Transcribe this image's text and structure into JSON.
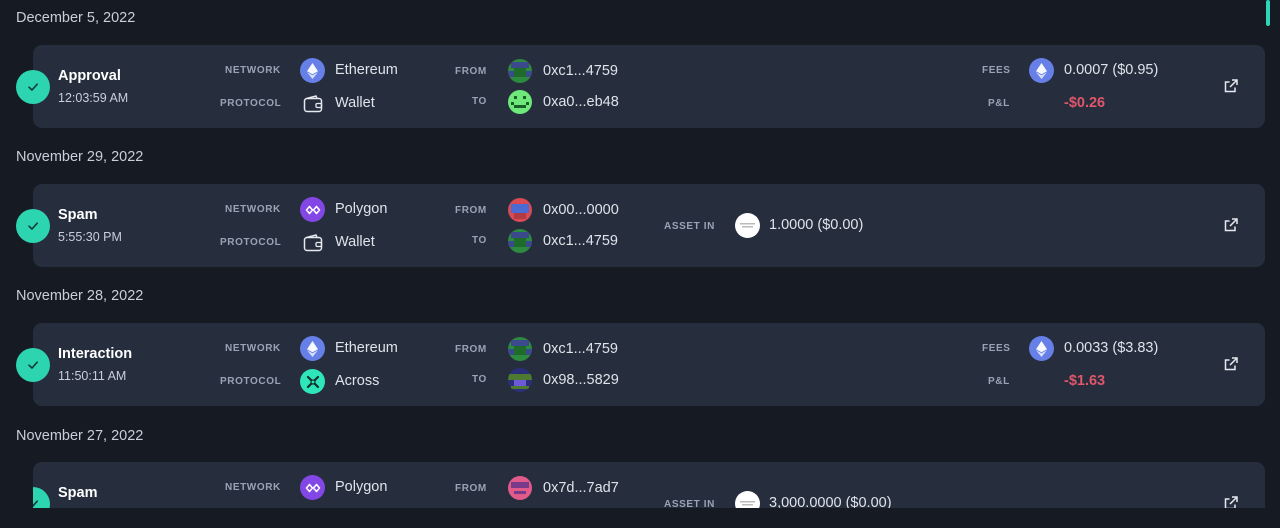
{
  "labels": {
    "network": "NETWORK",
    "protocol": "PROTOCOL",
    "from": "FROM",
    "to": "TO",
    "fees": "FEES",
    "pnl": "P&L",
    "asset_in": "ASSET IN"
  },
  "groups": [
    {
      "date": "December 5, 2022",
      "tx": {
        "type": "Approval",
        "time": "12:03:59 AM",
        "network": "Ethereum",
        "network_icon": "ethereum-icon",
        "protocol": "Wallet",
        "protocol_icon": "wallet-icon",
        "from": "0xc1...4759",
        "to": "0xa0...eb48",
        "fees": "0.0007 ($0.95)",
        "pnl": "-$0.26"
      }
    },
    {
      "date": "November 29, 2022",
      "tx": {
        "type": "Spam",
        "time": "5:55:30 PM",
        "network": "Polygon",
        "network_icon": "polygon-icon",
        "protocol": "Wallet",
        "protocol_icon": "wallet-icon",
        "from": "0x00...0000",
        "to": "0xc1...4759",
        "asset_in": "1.0000 ($0.00)"
      }
    },
    {
      "date": "November 28, 2022",
      "tx": {
        "type": "Interaction",
        "time": "11:50:11 AM",
        "network": "Ethereum",
        "network_icon": "ethereum-icon",
        "protocol": "Across",
        "protocol_icon": "across-icon",
        "from": "0xc1...4759",
        "to": "0x98...5829",
        "fees": "0.0033 ($3.83)",
        "pnl": "-$1.63"
      }
    },
    {
      "date": "November 27, 2022",
      "tx": {
        "type": "Spam",
        "network": "Polygon",
        "network_icon": "polygon-icon",
        "from": "0x7d...7ad7",
        "asset_in": "3,000.0000 ($0.00)"
      }
    }
  ],
  "colors": {
    "background": "#161a23",
    "card": "#262d3d",
    "accent": "#2dd4b0",
    "negative": "#e0566a",
    "ethereum": "#6680e8",
    "polygon": "#8247e5"
  }
}
